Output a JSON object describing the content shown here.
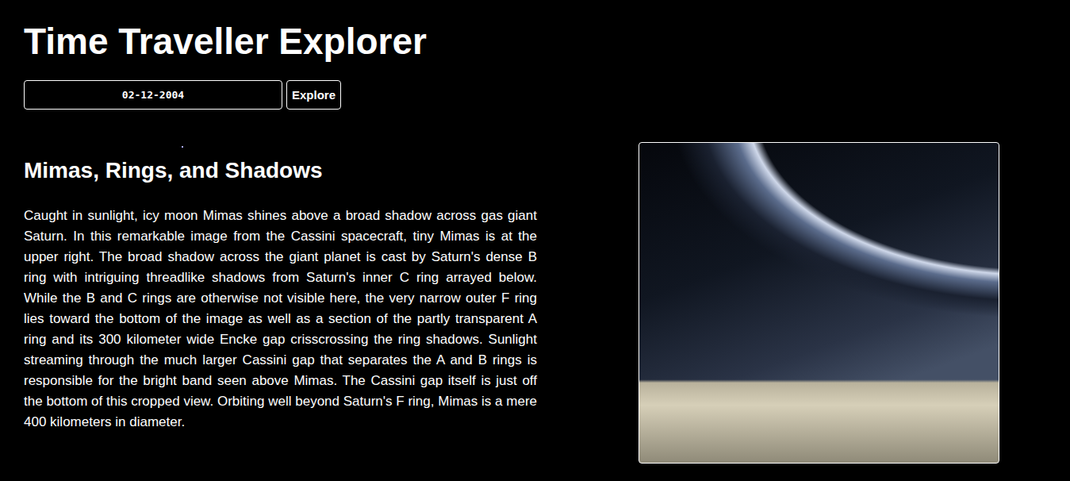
{
  "page": {
    "title": "Time Traveller Explorer"
  },
  "search": {
    "date_value": "02-12-2004",
    "button": "Explore"
  },
  "article": {
    "title": "Mimas, Rings, and Shadows",
    "description": "Caught in sunlight, icy moon Mimas shines above a broad shadow across gas giant Saturn. In this remarkable image from the Cassini spacecraft, tiny Mimas is at the upper right. The broad shadow across the giant planet is cast by Saturn's dense B ring with intriguing threadlike shadows from Saturn's inner C ring arrayed below. While the B and C rings are otherwise not visible here, the very narrow outer F ring lies toward the bottom of the image as well as a section of the partly transparent A ring and its 300 kilometer wide Encke gap crisscrossing the ring shadows. Sunlight streaming through the much larger Cassini gap that separates the A and B rings is responsible for the bright band seen above Mimas. The Cassini gap itself is just off the bottom of this cropped view. Orbiting well beyond Saturn's F ring, Mimas is a mere 400 kilometers in diameter."
  }
}
